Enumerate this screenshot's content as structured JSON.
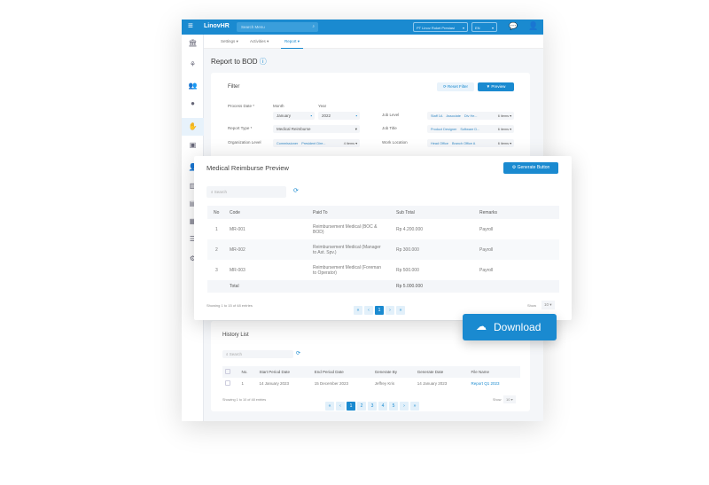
{
  "header": {
    "brand": "LinovHR",
    "search_placeholder": "Search Menu",
    "company": "PT Linov Roket Prestasi",
    "lang": "EN",
    "chat_badge": "",
    "accent": "#1a8ad0"
  },
  "tabs": [
    {
      "label": "Settings"
    },
    {
      "label": "Activities"
    },
    {
      "label": "Report"
    }
  ],
  "page": {
    "title": "Report to BOD"
  },
  "filter": {
    "title": "Filter",
    "reset": "Reset Filter",
    "preview": "Preview",
    "process_date": "Process Date *",
    "month_label": "Month",
    "year_label": "Year",
    "month": "January",
    "year": "2022",
    "report_type": "Report Type *",
    "report_type_value": "Medical Reimburse",
    "org_level": "Organization Level",
    "org_chips": [
      "Commissioner",
      "President Dire..."
    ],
    "org_more": "4 items",
    "job_level": "Job Level",
    "job_level_chips": [
      "Staff 1A",
      "Associate",
      "Div He..."
    ],
    "job_level_more": "6 items",
    "job_title": "Job Title",
    "job_title_chips": [
      "Product Designer",
      "Software D..."
    ],
    "job_title_more": "6 items",
    "work_location": "Work Location",
    "work_location_chips": [
      "Head Office",
      "Branch Office A"
    ],
    "work_location_more": "6 items"
  },
  "modal": {
    "title": "Medical Reimburse Preview",
    "generate": "Generate Button",
    "search_placeholder": "Search",
    "columns": [
      "No",
      "Code",
      "Paid To",
      "Sub Total",
      "Remarks"
    ],
    "rows": [
      [
        "1",
        "MR-001",
        "Reimbursement Medical (BOC & BOD)",
        "Rp 4.200.000",
        "Payroll"
      ],
      [
        "2",
        "MR-002",
        "Reimbursement Medical (Manager to Ast. Spv.)",
        "Rp 300.000",
        "Payroll"
      ],
      [
        "3",
        "MR-003",
        "Reimbursement Medical (Foreman to Operator)",
        "Rp 500.000",
        "Payroll"
      ]
    ],
    "total_label": "Total",
    "total_value": "Rp 5.000.000",
    "showing": "Showing 1 to 15 of 48 entries",
    "page": "1",
    "show_label": "Show",
    "show_value": "10"
  },
  "download": {
    "label": "Download"
  },
  "history": {
    "title": "History List",
    "search_placeholder": "Search",
    "columns": [
      "No.",
      "Start Period Date",
      "End Period Date",
      "Generate By",
      "Generate Date",
      "File Name"
    ],
    "rows": [
      [
        "1",
        "14 January 2023",
        "15 December 2023",
        "Jeffrey Kris",
        "14 January 2023",
        "Report Q1 2023"
      ]
    ],
    "showing": "Showing 1 to 10 of 48 entries",
    "pages": [
      "1",
      "2",
      "3",
      "4",
      "5"
    ],
    "show_label": "Show",
    "show_value": "10"
  }
}
